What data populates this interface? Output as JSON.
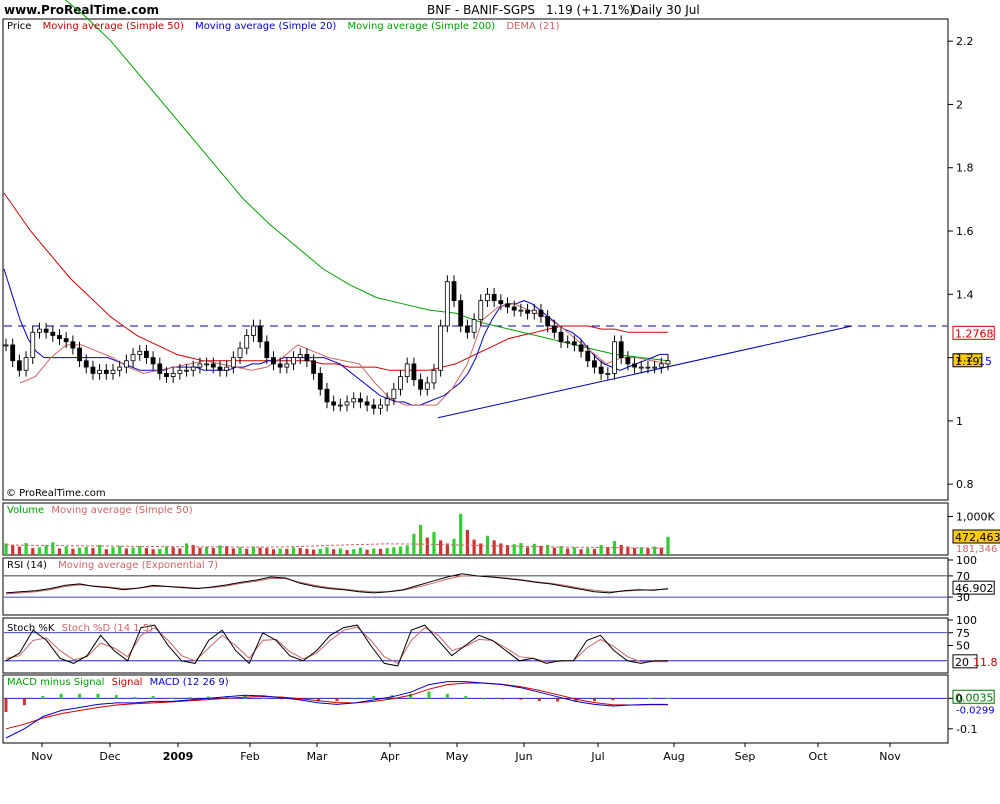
{
  "header": {
    "site": "www.ProRealTime.com",
    "symbol": "BNF - BANIF-SGPS",
    "quote": "1.19 (+1.71%)",
    "period": "Daily  30 Jul"
  },
  "copyright": "© ProRealTime.com",
  "colors": {
    "price": "#000000",
    "sma50": "#cc0000",
    "sma20": "#0000cc",
    "sma200": "#00a000",
    "dema": "#cc6666",
    "volume_up": "#33cc33",
    "volume_down": "#cc3333",
    "trendline": "#0000aa"
  },
  "x_axis": {
    "months": [
      "Nov",
      "Dec",
      "2009",
      "Feb",
      "Mar",
      "Apr",
      "May",
      "Jun",
      "Jul",
      "Aug",
      "Sep",
      "Oct",
      "Nov"
    ]
  },
  "chart_data": [
    {
      "panel": "price",
      "type": "candlestick",
      "legend": [
        "Price",
        "Moving average (Simple 50)",
        "Moving average (Simple 20)",
        "Moving average (Simple 200)",
        "DEMA (21)"
      ],
      "y_ticks": [
        "2.2",
        "2",
        "1.8",
        "1.6",
        "1.4",
        "1.2",
        "1",
        "0.8"
      ],
      "ylim": [
        0.75,
        2.27
      ],
      "resistance_level": 1.3,
      "trendline": {
        "start": [
          "Apr 22",
          1.01
        ],
        "end": [
          "Oct 20",
          1.3
        ]
      },
      "last_labels": {
        "sma50": "1.2768",
        "price": "1.19",
        "sma20": "15"
      },
      "price": [
        1.24,
        1.19,
        1.16,
        1.2,
        1.28,
        1.29,
        1.28,
        1.27,
        1.26,
        1.25,
        1.23,
        1.19,
        1.17,
        1.15,
        1.16,
        1.15,
        1.16,
        1.17,
        1.19,
        1.21,
        1.22,
        1.2,
        1.18,
        1.15,
        1.14,
        1.15,
        1.16,
        1.16,
        1.17,
        1.18,
        1.18,
        1.17,
        1.16,
        1.17,
        1.2,
        1.23,
        1.27,
        1.3,
        1.25,
        1.2,
        1.18,
        1.17,
        1.18,
        1.2,
        1.21,
        1.19,
        1.15,
        1.1,
        1.06,
        1.05,
        1.05,
        1.06,
        1.07,
        1.06,
        1.05,
        1.04,
        1.05,
        1.07,
        1.1,
        1.14,
        1.18,
        1.13,
        1.1,
        1.12,
        1.16,
        1.3,
        1.44,
        1.38,
        1.3,
        1.28,
        1.32,
        1.38,
        1.4,
        1.38,
        1.37,
        1.36,
        1.35,
        1.35,
        1.34,
        1.35,
        1.33,
        1.3,
        1.28,
        1.25,
        1.25,
        1.24,
        1.22,
        1.19,
        1.17,
        1.15,
        1.15,
        1.25,
        1.2,
        1.18,
        1.17,
        1.17,
        1.17,
        1.17,
        1.18,
        1.19
      ],
      "sma20": [
        1.48,
        1.4,
        1.32,
        1.26,
        1.22,
        1.2,
        1.2,
        1.2,
        1.2,
        1.2,
        1.2,
        1.2,
        1.2,
        1.2,
        1.19,
        1.18,
        1.17,
        1.16,
        1.16,
        1.16,
        1.16,
        1.17,
        1.17,
        1.17,
        1.17,
        1.16,
        1.16,
        1.16,
        1.16,
        1.17,
        1.17,
        1.18,
        1.18,
        1.19,
        1.19,
        1.2,
        1.2,
        1.2,
        1.2,
        1.2,
        1.2,
        1.19,
        1.18,
        1.16,
        1.14,
        1.12,
        1.1,
        1.08,
        1.07,
        1.06,
        1.06,
        1.05,
        1.05,
        1.06,
        1.07,
        1.08,
        1.1,
        1.12,
        1.15,
        1.2,
        1.27,
        1.32,
        1.36,
        1.37,
        1.37,
        1.38,
        1.37,
        1.35,
        1.33,
        1.31,
        1.29,
        1.28,
        1.26,
        1.23,
        1.2,
        1.18,
        1.17,
        1.16,
        1.17,
        1.18,
        1.19,
        1.2,
        1.21,
        1.21
      ],
      "sma50": [
        1.72,
        1.66,
        1.6,
        1.55,
        1.5,
        1.45,
        1.41,
        1.37,
        1.33,
        1.3,
        1.27,
        1.25,
        1.23,
        1.21,
        1.2,
        1.19,
        1.19,
        1.19,
        1.19,
        1.19,
        1.19,
        1.19,
        1.19,
        1.19,
        1.18,
        1.18,
        1.17,
        1.17,
        1.17,
        1.16,
        1.16,
        1.16,
        1.16,
        1.17,
        1.18,
        1.2,
        1.22,
        1.24,
        1.26,
        1.27,
        1.28,
        1.29,
        1.3,
        1.3,
        1.3,
        1.29,
        1.29,
        1.28,
        1.28,
        1.28,
        1.28
      ],
      "sma200": [
        2.35,
        2.28,
        2.2,
        2.1,
        2.0,
        1.9,
        1.8,
        1.7,
        1.62,
        1.55,
        1.48,
        1.43,
        1.39,
        1.37,
        1.35,
        1.34,
        1.31,
        1.29,
        1.27,
        1.25,
        1.23,
        1.21,
        1.2,
        1.19
      ],
      "dema": [
        1.12,
        1.14,
        1.2,
        1.24,
        1.24,
        1.22,
        1.2,
        1.17,
        1.15,
        1.16,
        1.17,
        1.18,
        1.19,
        1.18,
        1.17,
        1.16,
        1.17,
        1.2,
        1.24,
        1.22,
        1.2,
        1.19,
        1.18,
        1.12,
        1.07,
        1.05,
        1.05,
        1.05,
        1.1,
        1.18,
        1.32,
        1.36,
        1.37,
        1.35,
        1.33,
        1.3,
        1.26,
        1.22,
        1.18,
        1.2,
        1.2,
        1.19,
        1.18
      ]
    },
    {
      "panel": "volume",
      "type": "bar",
      "legend": [
        "Volume",
        "Moving average (Simple 50)"
      ],
      "y_ticks": [
        "1,000K"
      ],
      "ylim": [
        0,
        1350000
      ],
      "last_labels": {
        "volume": "472,463",
        "sma": "181,346"
      },
      "values": [
        300000,
        260000,
        220000,
        310000,
        180000,
        200000,
        250000,
        330000,
        170000,
        220000,
        160000,
        190000,
        210000,
        180000,
        260000,
        150000,
        200000,
        240000,
        170000,
        190000,
        230000,
        180000,
        150000,
        160000,
        220000,
        200000,
        170000,
        300000,
        260000,
        190000,
        210000,
        180000,
        250000,
        230000,
        170000,
        200000,
        160000,
        220000,
        190000,
        180000,
        150000,
        170000,
        160000,
        200000,
        180000,
        160000,
        140000,
        160000,
        200000,
        150000,
        170000,
        130000,
        150000,
        190000,
        140000,
        170000,
        160000,
        180000,
        200000,
        220000,
        250000,
        550000,
        780000,
        450000,
        600000,
        380000,
        300000,
        420000,
        1070000,
        650000,
        400000,
        300000,
        500000,
        380000,
        300000,
        260000,
        280000,
        310000,
        200000,
        290000,
        240000,
        260000,
        190000,
        230000,
        170000,
        200000,
        150000,
        180000,
        160000,
        260000,
        210000,
        360000,
        260000,
        220000,
        180000,
        200000,
        170000,
        220000,
        190000,
        472463
      ],
      "sma": [
        260000,
        250000,
        240000,
        230000,
        220000,
        215000,
        210000,
        205000,
        210000,
        240000,
        270000,
        290000,
        280000,
        260000,
        240000,
        220000,
        205000,
        195000,
        185000,
        181346
      ]
    },
    {
      "panel": "rsi",
      "type": "line",
      "legend": [
        "RSI (14)",
        "Moving average (Exponential 7)"
      ],
      "y_ticks": [
        "100",
        "70",
        "30"
      ],
      "ylim": [
        0,
        100
      ],
      "levels": [
        70,
        30
      ],
      "last_labels": {
        "rsi": "46.902"
      },
      "rsi": [
        38,
        40,
        42,
        46,
        52,
        55,
        50,
        48,
        44,
        47,
        52,
        50,
        48,
        46,
        49,
        53,
        58,
        62,
        68,
        66,
        56,
        50,
        46,
        44,
        40,
        38,
        40,
        44,
        52,
        60,
        68,
        74,
        70,
        68,
        65,
        62,
        58,
        55,
        50,
        45,
        40,
        38,
        42,
        44,
        43,
        46
      ],
      "ema": [
        36,
        38,
        40,
        44,
        50,
        53,
        51,
        49,
        46,
        47,
        50,
        50,
        49,
        47,
        48,
        51,
        56,
        60,
        65,
        65,
        58,
        52,
        48,
        45,
        42,
        40,
        40,
        43,
        49,
        56,
        64,
        70,
        70,
        68,
        66,
        63,
        59,
        56,
        52,
        47,
        43,
        40,
        41,
        43,
        44,
        45
      ]
    },
    {
      "panel": "stochastic",
      "type": "line",
      "legend": [
        "Stoch %K",
        "Stoch %D (14 1 5)"
      ],
      "y_ticks": [
        "100",
        "75",
        "50",
        "20"
      ],
      "ylim": [
        0,
        100
      ],
      "levels": [
        75,
        20
      ],
      "last_labels": {
        "d": "11.8",
        "k": "20"
      },
      "k": [
        20,
        35,
        80,
        60,
        25,
        15,
        30,
        70,
        40,
        20,
        85,
        90,
        50,
        20,
        15,
        60,
        80,
        40,
        15,
        75,
        60,
        30,
        20,
        40,
        70,
        85,
        90,
        50,
        15,
        10,
        80,
        90,
        60,
        30,
        50,
        70,
        60,
        40,
        20,
        25,
        15,
        20,
        20,
        60,
        70,
        40,
        20,
        15,
        20,
        20
      ],
      "d": [
        25,
        30,
        60,
        65,
        40,
        22,
        28,
        55,
        45,
        28,
        70,
        85,
        60,
        30,
        20,
        45,
        70,
        50,
        25,
        60,
        62,
        38,
        24,
        35,
        60,
        80,
        86,
        60,
        28,
        15,
        60,
        85,
        70,
        40,
        48,
        62,
        60,
        45,
        28,
        25,
        18,
        19,
        20,
        45,
        62,
        48,
        28,
        18,
        18,
        18
      ]
    },
    {
      "panel": "macd",
      "type": "line",
      "legend": [
        "MACD minus Signal",
        "Signal",
        "MACD (12 26 9)"
      ],
      "y_ticks": [
        "0",
        "-0.1"
      ],
      "ylim": [
        -0.14,
        0.07
      ],
      "last_labels": {
        "diff": "0.0035",
        "macd": "-0.0299"
      },
      "macd": [
        -0.13,
        -0.1,
        -0.06,
        -0.04,
        -0.03,
        -0.02,
        -0.015,
        -0.015,
        -0.01,
        -0.01,
        -0.005,
        0.0,
        0.005,
        0.01,
        0.008,
        0.002,
        -0.005,
        -0.015,
        -0.02,
        -0.015,
        -0.005,
        0.005,
        0.02,
        0.045,
        0.055,
        0.055,
        0.05,
        0.045,
        0.035,
        0.02,
        0.005,
        -0.01,
        -0.02,
        -0.025,
        -0.022,
        -0.02,
        -0.02
      ],
      "signal": [
        -0.1,
        -0.085,
        -0.065,
        -0.05,
        -0.04,
        -0.03,
        -0.022,
        -0.018,
        -0.015,
        -0.012,
        -0.008,
        -0.004,
        0.0,
        0.004,
        0.006,
        0.004,
        -0.001,
        -0.008,
        -0.014,
        -0.015,
        -0.01,
        -0.002,
        0.01,
        0.03,
        0.045,
        0.05,
        0.05,
        0.046,
        0.038,
        0.026,
        0.012,
        -0.003,
        -0.014,
        -0.021,
        -0.022,
        -0.021,
        -0.021
      ]
    }
  ]
}
